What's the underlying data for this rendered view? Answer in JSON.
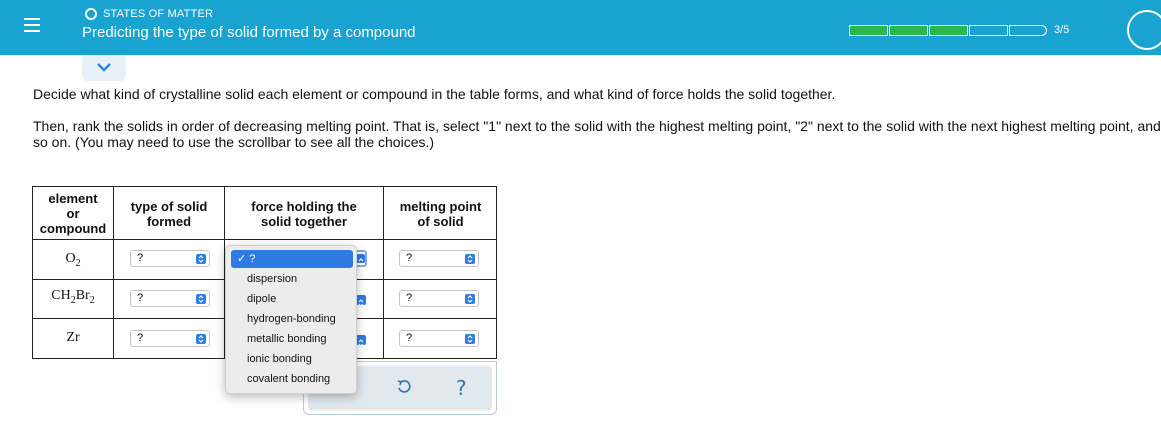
{
  "header": {
    "topic": "STATES OF MATTER",
    "title": "Predicting the type of solid formed by a compound",
    "progress_text": "3/5",
    "progress": 0.6,
    "bg_color": "#19a3d0"
  },
  "instructions": {
    "line1": "Decide what kind of crystalline solid each element or compound in the table forms, and what kind of force holds the solid together.",
    "line2": "Then, rank the solids in order of decreasing melting point. That is, select \"1\" next to the solid with the highest melting point, \"2\" next to the solid with the next highest melting point, and so on. (You may need to use the scrollbar to see all the choices.)"
  },
  "table": {
    "headers": {
      "element_1": "element",
      "element_2": "or",
      "element_3": "compound",
      "type_1": "type of solid",
      "type_2": "formed",
      "force_1": "force holding the",
      "force_2": "solid together",
      "melt_1": "melting point",
      "melt_2": "of solid"
    },
    "rows": [
      {
        "compound_main": "O",
        "compound_sub": "2",
        "type": "?",
        "force": "?",
        "melting": "?"
      },
      {
        "compound_main": "CH",
        "compound_sub": "2",
        "compound_main2": "Br",
        "compound_sub2": "2",
        "type": "?",
        "force": "?",
        "melting": "?"
      },
      {
        "compound_main": "Zr",
        "type": "?",
        "force": "?",
        "melting": "?"
      }
    ]
  },
  "dropdown": {
    "selected": "✓ ?",
    "options": [
      "dispersion",
      "dipole",
      "hydrogen-bonding",
      "metallic bonding",
      "ionic bonding",
      "covalent bonding"
    ]
  },
  "actions": {
    "undo_icon": "undo-icon",
    "help_label": "?"
  }
}
